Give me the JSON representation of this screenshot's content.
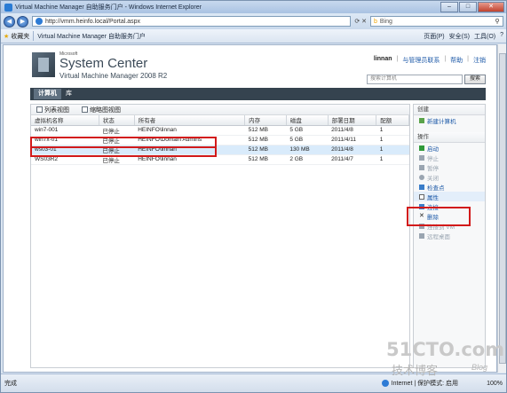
{
  "window": {
    "title": "Virtual Machine Manager 自助服务门户 - Windows Internet Explorer",
    "buttons": {
      "minimize": "–",
      "maximize": "□",
      "close": "✕"
    }
  },
  "address": {
    "url": "http://vmm.heinfo.local/Portal.aspx",
    "search_engine": "Bing"
  },
  "favorites": {
    "label": "收藏夹",
    "tab_title": "Virtual Machine Manager 自助服务门户",
    "tools": [
      "页面(P)",
      "安全(S)",
      "工具(O)",
      "?"
    ]
  },
  "portal": {
    "ms_label": "Microsoft",
    "product": "System Center",
    "subproduct": "Virtual Machine Manager 2008 R2",
    "user": "linnan",
    "links": [
      "与管理员联系",
      "帮助",
      "注销"
    ],
    "search_placeholder": "搜索计算机",
    "search_button": "搜索",
    "tabs": [
      "计算机",
      "库"
    ]
  },
  "toolbar": {
    "list_view": "列表视图",
    "thumb_view": "缩略图视图"
  },
  "grid": {
    "columns": [
      "虚拟机名称",
      "状态",
      "所有者",
      "内存",
      "磁盘",
      "部署日期",
      "配额"
    ],
    "rows": [
      [
        "win7-001",
        "已停止",
        "HEINFO\\linnan",
        "512 MB",
        "5 GB",
        "2011/4/8",
        "1"
      ],
      [
        "win7x-01",
        "已停止",
        "HEINFO\\Domain Admins",
        "512 MB",
        "5 GB",
        "2011/4/11",
        "1"
      ],
      [
        "ws03-01",
        "已停止",
        "HEINFO\\linnan",
        "512 MB",
        "130 MB",
        "2011/4/8",
        "1"
      ],
      [
        "WS03R2",
        "已停止",
        "HEINFO\\linnan",
        "512 MB",
        "2 GB",
        "2011/4/7",
        "1"
      ]
    ]
  },
  "actions": {
    "create_header": "创建",
    "new_computer": "新建计算机",
    "ops_header": "操作",
    "items": [
      "启动",
      "停止",
      "暂停",
      "关闭",
      "检查点",
      "属性",
      "连接",
      "删除",
      "连接到 VM",
      "远程桌面"
    ]
  },
  "status": {
    "done": "完成",
    "zone": "Internet | 保护模式: 启用",
    "zoom": "100%"
  },
  "watermark": {
    "site": "51CTO.com",
    "tagline": "技术博客",
    "blog": "Blog"
  },
  "colors": {
    "highlight": "#d21a1a",
    "nav_bar": "#35434f",
    "link": "#1e5aa8"
  }
}
